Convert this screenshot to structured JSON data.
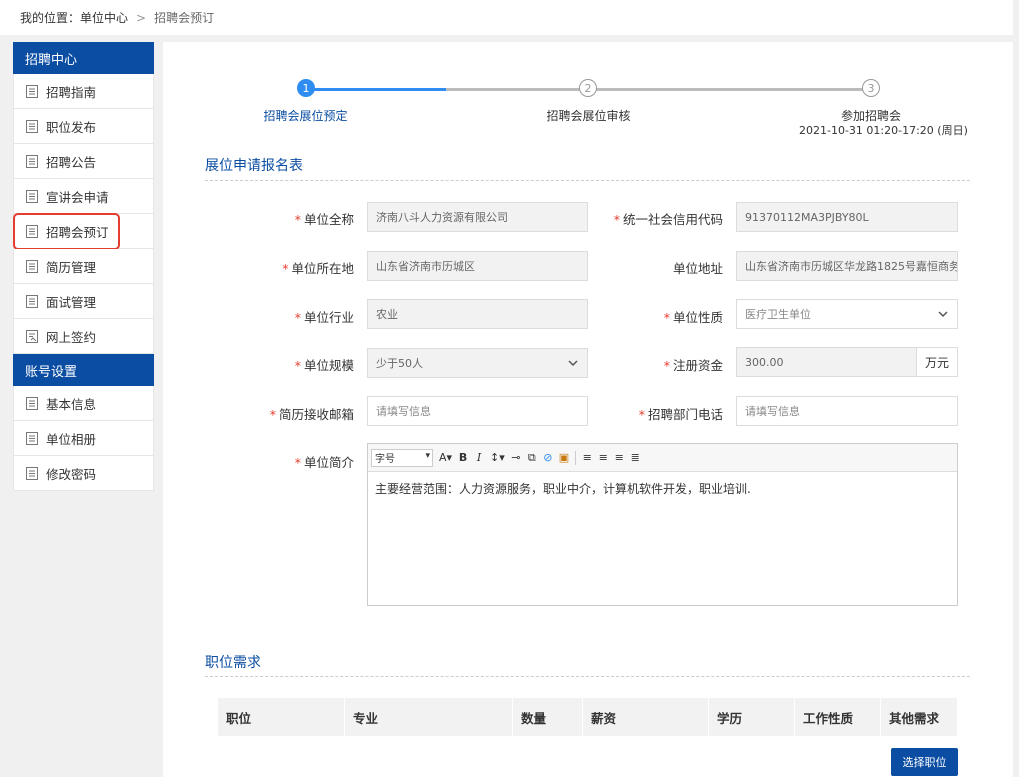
{
  "breadcrumb": {
    "prefix": "我的位置：",
    "items": [
      "单位中心",
      "招聘会预订"
    ]
  },
  "sidebar": {
    "groups": [
      {
        "title": "招聘中心",
        "items": [
          {
            "label": "招聘指南",
            "icon": "document-icon"
          },
          {
            "label": "职位发布",
            "icon": "document-icon"
          },
          {
            "label": "招聘公告",
            "icon": "document-icon"
          },
          {
            "label": "宣讲会申请",
            "icon": "document-icon"
          },
          {
            "label": "招聘会预订",
            "icon": "document-icon",
            "active": true
          },
          {
            "label": "简历管理",
            "icon": "document-icon"
          },
          {
            "label": "面试管理",
            "icon": "document-icon"
          },
          {
            "label": "网上签约",
            "icon": "contract-icon"
          }
        ]
      },
      {
        "title": "账号设置",
        "items": [
          {
            "label": "基本信息",
            "icon": "document-icon"
          },
          {
            "label": "单位相册",
            "icon": "document-icon"
          },
          {
            "label": "修改密码",
            "icon": "document-icon"
          }
        ]
      }
    ]
  },
  "steps": [
    {
      "num": "1",
      "label": "招聘会展位预定",
      "state": "active"
    },
    {
      "num": "2",
      "label": "招聘会展位审核",
      "state": "pending"
    },
    {
      "num": "3",
      "label": "参加招聘会",
      "date": "2021-10-31 01:20-17:20 (周日)",
      "state": "pending"
    }
  ],
  "form": {
    "title": "展位申请报名表",
    "unit_name": {
      "label": "单位全称",
      "value": "济南八斗人力资源有限公司"
    },
    "credit_code": {
      "label": "统一社会信用代码",
      "value": "91370112MA3PJBY80L"
    },
    "location": {
      "label": "单位所在地",
      "value": "山东省济南市历城区"
    },
    "address": {
      "label": "单位地址",
      "value": "山东省济南市历城区华龙路1825号嘉恒商务..."
    },
    "industry": {
      "label": "单位行业",
      "value": "农业"
    },
    "nature": {
      "label": "单位性质",
      "value": "医疗卫生单位"
    },
    "scale": {
      "label": "单位规模",
      "value": "少于50人"
    },
    "capital": {
      "label": "注册资金",
      "value": "300.00",
      "unit": "万元"
    },
    "resume_email": {
      "label": "简历接收邮箱",
      "placeholder": "请填写信息"
    },
    "dept_phone": {
      "label": "招聘部门电话",
      "placeholder": "请填写信息"
    },
    "intro": {
      "label": "单位简介",
      "font_select": "字号",
      "content": "主要经营范围：人力资源服务，职业中介，计算机软件开发，职业培训."
    }
  },
  "positions": {
    "title": "职位需求",
    "columns": [
      "职位",
      "专业",
      "数量",
      "薪资",
      "学历",
      "工作性质",
      "其他需求"
    ],
    "select_button": "选择职位"
  },
  "colors": {
    "brand": "#0a4da2",
    "step_active": "#2f8cf0",
    "required": "#e63c2e",
    "highlight_box": "#e63c2e"
  }
}
